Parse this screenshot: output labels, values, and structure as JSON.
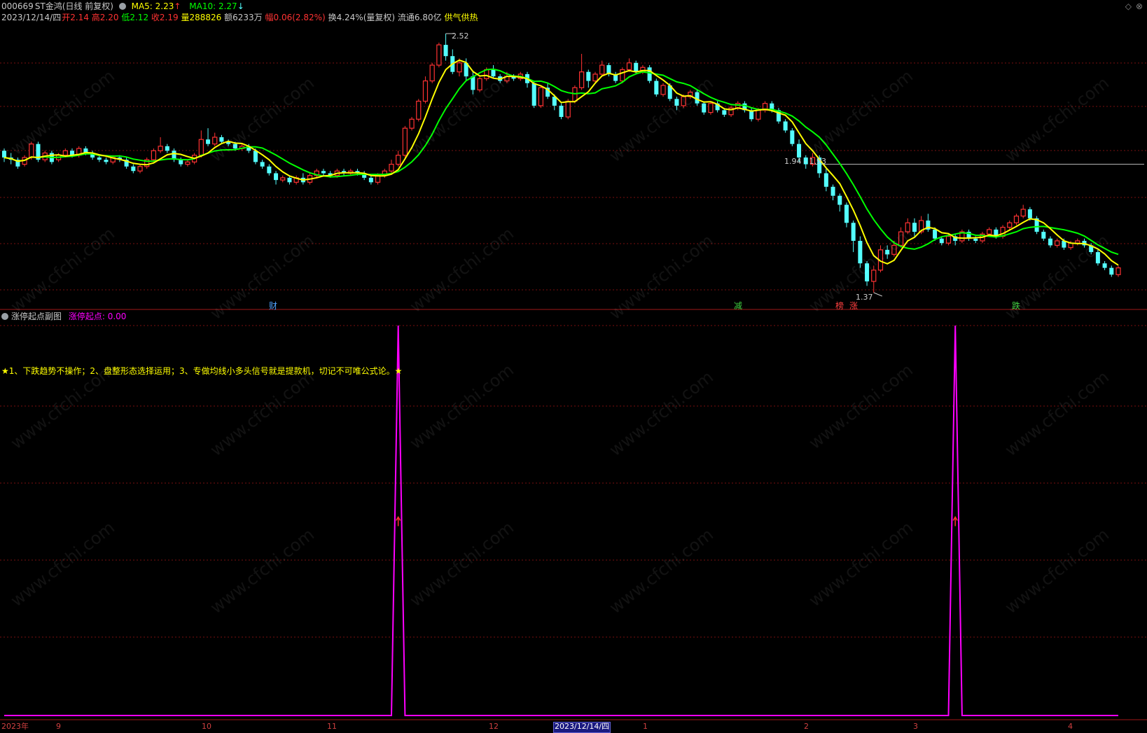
{
  "header": {
    "code": "000669",
    "name": "ST金鸿",
    "period": "(日线 前复权)",
    "ma5_label": "MA5: 2.23",
    "ma5_arrow": "↑",
    "ma10_label": "MA10: 2.27",
    "ma10_arrow": "↓",
    "date": "2023/12/14/四",
    "open_label": "开",
    "open": "2.14",
    "high_label": "高",
    "high": "2.20",
    "low_label": "低",
    "low": "2.12",
    "close_label": "收",
    "close": "2.19",
    "volume_label": "量",
    "volume": "288826",
    "amount_label": "额",
    "amount": "6233万",
    "change_label": "幅",
    "change": "0.06(2.82%)",
    "turnover_label": "换",
    "turnover": "4.24%(量复权)",
    "float_label": "流通",
    "float_value": "6.80亿",
    "extra": "供气供热"
  },
  "main_chart": {
    "price_high_label": "2.52",
    "price_low_label": "1.37",
    "ref_line_label": "1.94 - 1.93",
    "tags": [
      {
        "text": "财",
        "color": "#4fa3ff"
      },
      {
        "text": "减",
        "color": "#40d040"
      },
      {
        "text": "榜",
        "color": "#ff4040"
      },
      {
        "text": "涨",
        "color": "#ff4040"
      },
      {
        "text": "跌",
        "color": "#40d040"
      }
    ]
  },
  "sub_chart": {
    "title": "涨停起点副图",
    "indicator_label": "涨停起点: 0.00",
    "notice": "★1、下跌趋势不操作；2、盘整形态选择运用；3、专做均线小多头信号就是提款机，切记不可唯公式论。★"
  },
  "x_axis": {
    "labels": [
      "2023年",
      "9",
      "10",
      "11",
      "12",
      "2023/12/14/四",
      "1",
      "2",
      "3",
      "4"
    ]
  },
  "watermark": "www.cfchi.com",
  "colors": {
    "up": "#ff3232",
    "down": "#54ffff",
    "ma5": "#ffff00",
    "ma10": "#00ff00",
    "signal": "#ff00ff",
    "grid": "#7a1010"
  },
  "chart_data": {
    "type": "candlestick",
    "title": "",
    "ylim": [
      1.37,
      2.52
    ],
    "max_marker": 2.52,
    "min_marker": 1.37,
    "reference_line": [
      1.94,
      1.93
    ],
    "candles": [
      [
        2.0,
        1.97,
        2.01,
        1.95
      ],
      [
        1.97,
        1.96,
        1.99,
        1.94
      ],
      [
        1.96,
        1.93,
        1.97,
        1.92
      ],
      [
        1.94,
        1.97,
        1.98,
        1.93
      ],
      [
        1.97,
        2.03,
        2.04,
        1.96
      ],
      [
        2.03,
        1.96,
        2.04,
        1.95
      ],
      [
        1.96,
        1.99,
        2.0,
        1.95
      ],
      [
        1.99,
        1.95,
        2.0,
        1.94
      ],
      [
        1.96,
        1.98,
        1.99,
        1.95
      ],
      [
        1.98,
        2.0,
        2.01,
        1.97
      ],
      [
        2.0,
        1.98,
        2.01,
        1.97
      ],
      [
        1.98,
        2.01,
        2.02,
        1.97
      ],
      [
        2.01,
        1.99,
        2.02,
        1.98
      ],
      [
        1.99,
        1.97,
        2.0,
        1.96
      ],
      [
        1.97,
        1.96,
        1.98,
        1.95
      ],
      [
        1.96,
        1.95,
        1.97,
        1.94
      ],
      [
        1.95,
        1.97,
        1.98,
        1.94
      ],
      [
        1.97,
        1.96,
        1.98,
        1.95
      ],
      [
        1.96,
        1.93,
        1.97,
        1.92
      ],
      [
        1.93,
        1.91,
        1.94,
        1.9
      ],
      [
        1.91,
        1.93,
        1.94,
        1.9
      ],
      [
        1.93,
        1.96,
        1.97,
        1.92
      ],
      [
        1.96,
        2.0,
        2.01,
        1.95
      ],
      [
        2.0,
        2.02,
        2.06,
        1.99
      ],
      [
        2.02,
        2.0,
        2.03,
        1.99
      ],
      [
        2.0,
        1.96,
        2.01,
        1.95
      ],
      [
        1.96,
        1.94,
        1.97,
        1.93
      ],
      [
        1.94,
        1.95,
        1.96,
        1.93
      ],
      [
        1.95,
        1.98,
        1.99,
        1.94
      ],
      [
        1.98,
        2.05,
        2.09,
        1.97
      ],
      [
        2.05,
        2.03,
        2.1,
        2.02
      ],
      [
        2.03,
        2.06,
        2.08,
        2.02
      ],
      [
        2.06,
        2.04,
        2.07,
        2.03
      ],
      [
        2.04,
        2.03,
        2.05,
        2.02
      ],
      [
        2.03,
        2.01,
        2.04,
        2.0
      ],
      [
        2.01,
        2.02,
        2.03,
        2.0
      ],
      [
        2.02,
        2.0,
        2.03,
        1.99
      ],
      [
        2.0,
        1.95,
        2.01,
        1.94
      ],
      [
        1.95,
        1.93,
        1.96,
        1.92
      ],
      [
        1.93,
        1.9,
        1.94,
        1.89
      ],
      [
        1.9,
        1.87,
        1.91,
        1.85
      ],
      [
        1.87,
        1.88,
        1.89,
        1.86
      ],
      [
        1.88,
        1.86,
        1.89,
        1.85
      ],
      [
        1.86,
        1.88,
        1.89,
        1.85
      ],
      [
        1.88,
        1.86,
        1.9,
        1.85
      ],
      [
        1.86,
        1.89,
        1.9,
        1.85
      ],
      [
        1.89,
        1.91,
        1.92,
        1.88
      ],
      [
        1.91,
        1.9,
        1.92,
        1.89
      ],
      [
        1.9,
        1.89,
        1.91,
        1.88
      ],
      [
        1.89,
        1.91,
        1.92,
        1.88
      ],
      [
        1.91,
        1.9,
        1.92,
        1.89
      ],
      [
        1.9,
        1.91,
        1.92,
        1.89
      ],
      [
        1.91,
        1.9,
        1.92,
        1.89
      ],
      [
        1.9,
        1.88,
        1.91,
        1.87
      ],
      [
        1.88,
        1.86,
        1.89,
        1.85
      ],
      [
        1.86,
        1.89,
        1.9,
        1.85
      ],
      [
        1.89,
        1.91,
        1.92,
        1.88
      ],
      [
        1.91,
        1.94,
        1.96,
        1.9
      ],
      [
        1.94,
        1.98,
        2.0,
        1.93
      ],
      [
        1.98,
        2.1,
        2.11,
        1.97
      ],
      [
        2.1,
        2.14,
        2.15,
        2.09
      ],
      [
        2.14,
        2.22,
        2.23,
        2.13
      ],
      [
        2.22,
        2.31,
        2.33,
        2.21
      ],
      [
        2.31,
        2.38,
        2.39,
        2.3
      ],
      [
        2.38,
        2.47,
        2.48,
        2.37
      ],
      [
        2.47,
        2.42,
        2.52,
        2.4
      ],
      [
        2.42,
        2.35,
        2.45,
        2.34
      ],
      [
        2.35,
        2.39,
        2.41,
        2.33
      ],
      [
        2.39,
        2.33,
        2.41,
        2.31
      ],
      [
        2.33,
        2.27,
        2.35,
        2.25
      ],
      [
        2.27,
        2.32,
        2.33,
        2.26
      ],
      [
        2.32,
        2.36,
        2.37,
        2.31
      ],
      [
        2.36,
        2.33,
        2.38,
        2.32
      ],
      [
        2.33,
        2.31,
        2.34,
        2.3
      ],
      [
        2.31,
        2.33,
        2.35,
        2.3
      ],
      [
        2.33,
        2.32,
        2.34,
        2.31
      ],
      [
        2.32,
        2.34,
        2.35,
        2.31
      ],
      [
        2.34,
        2.3,
        2.35,
        2.28
      ],
      [
        2.3,
        2.2,
        2.31,
        2.19
      ],
      [
        2.2,
        2.28,
        2.29,
        2.19
      ],
      [
        2.28,
        2.24,
        2.3,
        2.23
      ],
      [
        2.24,
        2.2,
        2.25,
        2.18
      ],
      [
        2.2,
        2.15,
        2.21,
        2.14
      ],
      [
        2.15,
        2.22,
        2.23,
        2.14
      ],
      [
        2.22,
        2.28,
        2.29,
        2.21
      ],
      [
        2.28,
        2.35,
        2.43,
        2.27
      ],
      [
        2.35,
        2.31,
        2.36,
        2.28
      ],
      [
        2.31,
        2.34,
        2.35,
        2.3
      ],
      [
        2.34,
        2.38,
        2.4,
        2.33
      ],
      [
        2.38,
        2.34,
        2.39,
        2.33
      ],
      [
        2.34,
        2.31,
        2.35,
        2.3
      ],
      [
        2.31,
        2.36,
        2.37,
        2.3
      ],
      [
        2.36,
        2.39,
        2.41,
        2.35
      ],
      [
        2.39,
        2.35,
        2.4,
        2.34
      ],
      [
        2.35,
        2.37,
        2.38,
        2.34
      ],
      [
        2.37,
        2.31,
        2.38,
        2.3
      ],
      [
        2.31,
        2.25,
        2.32,
        2.24
      ],
      [
        2.25,
        2.29,
        2.3,
        2.24
      ],
      [
        2.29,
        2.23,
        2.3,
        2.22
      ],
      [
        2.23,
        2.2,
        2.24,
        2.18
      ],
      [
        2.2,
        2.24,
        2.25,
        2.19
      ],
      [
        2.24,
        2.26,
        2.27,
        2.23
      ],
      [
        2.26,
        2.21,
        2.27,
        2.2
      ],
      [
        2.21,
        2.17,
        2.22,
        2.16
      ],
      [
        2.17,
        2.21,
        2.22,
        2.16
      ],
      [
        2.21,
        2.18,
        2.22,
        2.17
      ],
      [
        2.18,
        2.16,
        2.19,
        2.15
      ],
      [
        2.16,
        2.19,
        2.2,
        2.15
      ],
      [
        2.19,
        2.21,
        2.22,
        2.18
      ],
      [
        2.21,
        2.18,
        2.22,
        2.17
      ],
      [
        2.18,
        2.14,
        2.19,
        2.13
      ],
      [
        2.14,
        2.18,
        2.19,
        2.13
      ],
      [
        2.18,
        2.21,
        2.22,
        2.17
      ],
      [
        2.21,
        2.18,
        2.22,
        2.17
      ],
      [
        2.18,
        2.13,
        2.19,
        2.12
      ],
      [
        2.13,
        2.09,
        2.14,
        2.08
      ],
      [
        2.09,
        2.03,
        2.1,
        2.02
      ],
      [
        2.03,
        1.97,
        2.05,
        1.95
      ],
      [
        1.97,
        1.94,
        1.98,
        1.92
      ],
      [
        1.94,
        1.97,
        1.99,
        1.93
      ],
      [
        1.97,
        1.9,
        1.98,
        1.88
      ],
      [
        1.9,
        1.84,
        1.92,
        1.82
      ],
      [
        1.84,
        1.8,
        1.85,
        1.78
      ],
      [
        1.8,
        1.76,
        1.81,
        1.73
      ],
      [
        1.76,
        1.68,
        1.77,
        1.66
      ],
      [
        1.68,
        1.6,
        1.69,
        1.55
      ],
      [
        1.6,
        1.5,
        1.62,
        1.48
      ],
      [
        1.5,
        1.42,
        1.51,
        1.4
      ],
      [
        1.42,
        1.47,
        1.49,
        1.37
      ],
      [
        1.47,
        1.56,
        1.58,
        1.46
      ],
      [
        1.56,
        1.54,
        1.58,
        1.52
      ],
      [
        1.54,
        1.58,
        1.6,
        1.53
      ],
      [
        1.58,
        1.64,
        1.66,
        1.57
      ],
      [
        1.64,
        1.68,
        1.7,
        1.63
      ],
      [
        1.68,
        1.64,
        1.7,
        1.62
      ],
      [
        1.64,
        1.69,
        1.71,
        1.63
      ],
      [
        1.69,
        1.65,
        1.72,
        1.64
      ],
      [
        1.65,
        1.61,
        1.66,
        1.6
      ],
      [
        1.61,
        1.59,
        1.62,
        1.58
      ],
      [
        1.59,
        1.62,
        1.63,
        1.58
      ],
      [
        1.62,
        1.6,
        1.63,
        1.58
      ],
      [
        1.6,
        1.64,
        1.65,
        1.59
      ],
      [
        1.64,
        1.61,
        1.65,
        1.6
      ],
      [
        1.61,
        1.6,
        1.62,
        1.59
      ],
      [
        1.6,
        1.63,
        1.64,
        1.59
      ],
      [
        1.63,
        1.65,
        1.66,
        1.62
      ],
      [
        1.65,
        1.62,
        1.66,
        1.61
      ],
      [
        1.62,
        1.66,
        1.67,
        1.61
      ],
      [
        1.66,
        1.68,
        1.69,
        1.65
      ],
      [
        1.68,
        1.71,
        1.72,
        1.67
      ],
      [
        1.71,
        1.74,
        1.76,
        1.7
      ],
      [
        1.74,
        1.7,
        1.75,
        1.69
      ],
      [
        1.7,
        1.64,
        1.71,
        1.63
      ],
      [
        1.64,
        1.61,
        1.65,
        1.6
      ],
      [
        1.61,
        1.58,
        1.62,
        1.57
      ],
      [
        1.58,
        1.6,
        1.61,
        1.57
      ],
      [
        1.6,
        1.57,
        1.61,
        1.56
      ],
      [
        1.57,
        1.59,
        1.6,
        1.56
      ],
      [
        1.59,
        1.6,
        1.61,
        1.58
      ],
      [
        1.6,
        1.58,
        1.61,
        1.57
      ],
      [
        1.58,
        1.55,
        1.59,
        1.54
      ],
      [
        1.55,
        1.5,
        1.56,
        1.49
      ],
      [
        1.5,
        1.48,
        1.51,
        1.47
      ],
      [
        1.48,
        1.45,
        1.49,
        1.44
      ],
      [
        1.45,
        1.48,
        1.49,
        1.44
      ]
    ],
    "signal_series": {
      "name": "涨停起点",
      "peaks_at_index": [
        58,
        140
      ],
      "peak_value": 1,
      "base_value": 0
    }
  }
}
